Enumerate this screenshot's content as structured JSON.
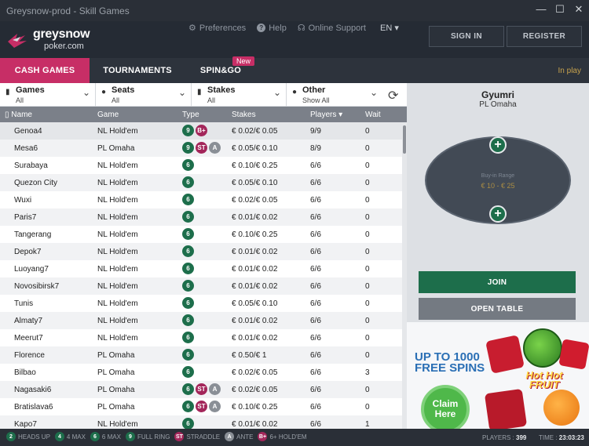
{
  "window": {
    "title": "Greysnow-prod - Skill Games",
    "minimize": "—",
    "maximize": "☐",
    "close": "✕"
  },
  "header": {
    "logo_line1": "greysnow",
    "logo_line2": "poker.com",
    "nav": [
      {
        "icon": "gear-icon",
        "glyph": "⚙",
        "label": "Preferences"
      },
      {
        "icon": "help-icon",
        "glyph": "?",
        "label": "Help"
      },
      {
        "icon": "headset-icon",
        "glyph": "☊",
        "label": "Online Support"
      }
    ],
    "language": "EN ▾",
    "sign_in": "SIGN IN",
    "register": "REGISTER"
  },
  "tabs": {
    "cash_games": "CASH GAMES",
    "tournaments": "TOURNAMENTS",
    "spin_go": "SPIN&GO",
    "new_badge": "New",
    "in_play": "In play"
  },
  "filters": [
    {
      "icon": "cards-icon",
      "glyph": "▮",
      "label": "Games",
      "value": "All"
    },
    {
      "icon": "seats-icon",
      "glyph": "●",
      "label": "Seats",
      "value": "All"
    },
    {
      "icon": "stakes-icon",
      "glyph": "▮",
      "label": "Stakes",
      "value": "All"
    },
    {
      "icon": "other-icon",
      "glyph": "●",
      "label": "Other",
      "value": "Show All"
    }
  ],
  "columns": {
    "name": "Name",
    "game": "Game",
    "type": "Type",
    "stakes": "Stakes",
    "players": "Players ▾",
    "wait": "Wait"
  },
  "rows": [
    {
      "name": "Genoa4",
      "game": "NL Hold'em",
      "badges": [
        [
          "9",
          "g"
        ],
        [
          "B+",
          "p"
        ]
      ],
      "stakes": "€ 0.02/€ 0.05",
      "players": "9/9",
      "wait": "0"
    },
    {
      "name": "Mesa6",
      "game": "PL Omaha",
      "badges": [
        [
          "9",
          "g"
        ],
        [
          "ST",
          "p"
        ],
        [
          "A",
          "gr"
        ]
      ],
      "stakes": "€ 0.05/€ 0.10",
      "players": "8/9",
      "wait": "0"
    },
    {
      "name": "Surabaya",
      "game": "NL Hold'em",
      "badges": [
        [
          "6",
          "g"
        ]
      ],
      "stakes": "€ 0.10/€ 0.25",
      "players": "6/6",
      "wait": "0"
    },
    {
      "name": "Quezon City",
      "game": "NL Hold'em",
      "badges": [
        [
          "6",
          "g"
        ]
      ],
      "stakes": "€ 0.05/€ 0.10",
      "players": "6/6",
      "wait": "0"
    },
    {
      "name": "Wuxi",
      "game": "NL Hold'em",
      "badges": [
        [
          "6",
          "g"
        ]
      ],
      "stakes": "€ 0.02/€ 0.05",
      "players": "6/6",
      "wait": "0"
    },
    {
      "name": "Paris7",
      "game": "NL Hold'em",
      "badges": [
        [
          "6",
          "g"
        ]
      ],
      "stakes": "€ 0.01/€ 0.02",
      "players": "6/6",
      "wait": "0"
    },
    {
      "name": "Tangerang",
      "game": "NL Hold'em",
      "badges": [
        [
          "6",
          "g"
        ]
      ],
      "stakes": "€ 0.10/€ 0.25",
      "players": "6/6",
      "wait": "0"
    },
    {
      "name": "Depok7",
      "game": "NL Hold'em",
      "badges": [
        [
          "6",
          "g"
        ]
      ],
      "stakes": "€ 0.01/€ 0.02",
      "players": "6/6",
      "wait": "0"
    },
    {
      "name": "Luoyang7",
      "game": "NL Hold'em",
      "badges": [
        [
          "6",
          "g"
        ]
      ],
      "stakes": "€ 0.01/€ 0.02",
      "players": "6/6",
      "wait": "0"
    },
    {
      "name": "Novosibirsk7",
      "game": "NL Hold'em",
      "badges": [
        [
          "6",
          "g"
        ]
      ],
      "stakes": "€ 0.01/€ 0.02",
      "players": "6/6",
      "wait": "0"
    },
    {
      "name": "Tunis",
      "game": "NL Hold'em",
      "badges": [
        [
          "6",
          "g"
        ]
      ],
      "stakes": "€ 0.05/€ 0.10",
      "players": "6/6",
      "wait": "0"
    },
    {
      "name": "Almaty7",
      "game": "NL Hold'em",
      "badges": [
        [
          "6",
          "g"
        ]
      ],
      "stakes": "€ 0.01/€ 0.02",
      "players": "6/6",
      "wait": "0"
    },
    {
      "name": "Meerut7",
      "game": "NL Hold'em",
      "badges": [
        [
          "6",
          "g"
        ]
      ],
      "stakes": "€ 0.01/€ 0.02",
      "players": "6/6",
      "wait": "0"
    },
    {
      "name": "Florence",
      "game": "PL Omaha",
      "badges": [
        [
          "6",
          "g"
        ]
      ],
      "stakes": "€ 0.50/€ 1",
      "players": "6/6",
      "wait": "0"
    },
    {
      "name": "Bilbao",
      "game": "PL Omaha",
      "badges": [
        [
          "6",
          "g"
        ]
      ],
      "stakes": "€ 0.02/€ 0.05",
      "players": "6/6",
      "wait": "3"
    },
    {
      "name": "Nagasaki6",
      "game": "PL Omaha",
      "badges": [
        [
          "6",
          "g"
        ],
        [
          "ST",
          "p"
        ],
        [
          "A",
          "gr"
        ]
      ],
      "stakes": "€ 0.02/€ 0.05",
      "players": "6/6",
      "wait": "0"
    },
    {
      "name": "Bratislava6",
      "game": "PL Omaha",
      "badges": [
        [
          "6",
          "g"
        ],
        [
          "ST",
          "p"
        ],
        [
          "A",
          "gr"
        ]
      ],
      "stakes": "€ 0.10/€ 0.25",
      "players": "6/6",
      "wait": "0"
    },
    {
      "name": "Kapo7",
      "game": "NL Hold'em",
      "badges": [
        [
          "6",
          "g"
        ]
      ],
      "stakes": "€ 0.01/€ 0.02",
      "players": "6/6",
      "wait": "1"
    }
  ],
  "detail": {
    "table_name": "Gyumri",
    "game": "PL Omaha",
    "buyin_label": "Buy-in Range",
    "buyin_value": "€ 10 - € 25",
    "join": "JOIN",
    "open_table": "OPEN TABLE"
  },
  "promo": {
    "headline": "UP TO 1000 FREE SPINS",
    "claim": "Claim Here",
    "brand": "Hot Hot FRUIT"
  },
  "legend": [
    {
      "badge": "2",
      "cls": "g",
      "label": "HEADS UP"
    },
    {
      "badge": "4",
      "cls": "g",
      "label": "4 MAX"
    },
    {
      "badge": "6",
      "cls": "g",
      "label": "6 MAX"
    },
    {
      "badge": "9",
      "cls": "g",
      "label": "FULL RING"
    },
    {
      "badge": "ST",
      "cls": "p",
      "label": "STRADDLE"
    },
    {
      "badge": "A",
      "cls": "gr",
      "label": "ANTE"
    },
    {
      "badge": "B+",
      "cls": "p",
      "label": "6+ HOLD'EM"
    }
  ],
  "status": {
    "players_label": "PLAYERS :",
    "players_value": "399",
    "time_label": "TIME :",
    "time_value": "23:03:23"
  },
  "colors": {
    "accent": "#c72e66",
    "join_green": "#1d6e4b",
    "in_play": "#c7a24d",
    "promo_blue": "#2a6fb5"
  }
}
